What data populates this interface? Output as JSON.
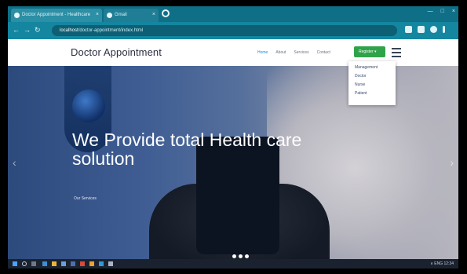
{
  "browser": {
    "tabs": [
      {
        "label": "Doctor Appointment - Healthcare",
        "close": "×"
      },
      {
        "label": "Gmail",
        "close": "×"
      }
    ],
    "window_buttons": [
      "—",
      "□",
      "×"
    ],
    "nav": {
      "back": "←",
      "forward": "→",
      "reload": "↻"
    },
    "url_host": "localhost",
    "url_path": "/doctor-appointment/index.html"
  },
  "site": {
    "brand": "Doctor Appointment",
    "menu": [
      "Home",
      "About",
      "Services",
      "Contact"
    ],
    "signin_label": "Register ▾",
    "dropdown_items": [
      "Management",
      "Doctor",
      "Nurse",
      "Patient"
    ]
  },
  "hero": {
    "title": "We Provide total Health care solution",
    "link": "Our Services",
    "prev": "‹",
    "next": "›"
  },
  "taskbar": {
    "tray_text": "∧ ENG 12:34"
  },
  "colors": {
    "tabbar": "#0f6f86",
    "addressbar": "#1486a0",
    "signin": "#2fa34a",
    "menu_active": "#1e88e5"
  }
}
